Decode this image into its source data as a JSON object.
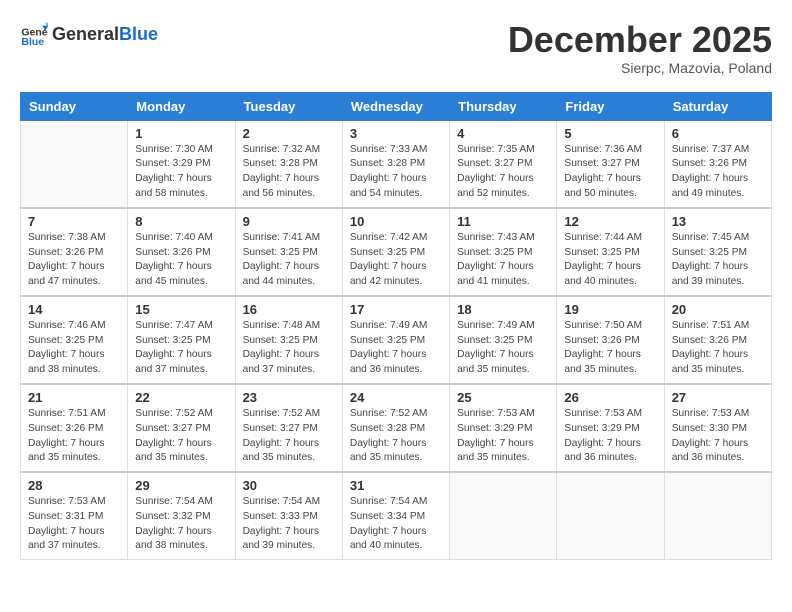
{
  "header": {
    "logo_general": "General",
    "logo_blue": "Blue",
    "month_title": "December 2025",
    "subtitle": "Sierpc, Mazovia, Poland"
  },
  "days_of_week": [
    "Sunday",
    "Monday",
    "Tuesday",
    "Wednesday",
    "Thursday",
    "Friday",
    "Saturday"
  ],
  "weeks": [
    [
      {
        "day": "",
        "info": ""
      },
      {
        "day": "1",
        "info": "Sunrise: 7:30 AM\nSunset: 3:29 PM\nDaylight: 7 hours\nand 58 minutes."
      },
      {
        "day": "2",
        "info": "Sunrise: 7:32 AM\nSunset: 3:28 PM\nDaylight: 7 hours\nand 56 minutes."
      },
      {
        "day": "3",
        "info": "Sunrise: 7:33 AM\nSunset: 3:28 PM\nDaylight: 7 hours\nand 54 minutes."
      },
      {
        "day": "4",
        "info": "Sunrise: 7:35 AM\nSunset: 3:27 PM\nDaylight: 7 hours\nand 52 minutes."
      },
      {
        "day": "5",
        "info": "Sunrise: 7:36 AM\nSunset: 3:27 PM\nDaylight: 7 hours\nand 50 minutes."
      },
      {
        "day": "6",
        "info": "Sunrise: 7:37 AM\nSunset: 3:26 PM\nDaylight: 7 hours\nand 49 minutes."
      }
    ],
    [
      {
        "day": "7",
        "info": "Sunrise: 7:38 AM\nSunset: 3:26 PM\nDaylight: 7 hours\nand 47 minutes."
      },
      {
        "day": "8",
        "info": "Sunrise: 7:40 AM\nSunset: 3:26 PM\nDaylight: 7 hours\nand 45 minutes."
      },
      {
        "day": "9",
        "info": "Sunrise: 7:41 AM\nSunset: 3:25 PM\nDaylight: 7 hours\nand 44 minutes."
      },
      {
        "day": "10",
        "info": "Sunrise: 7:42 AM\nSunset: 3:25 PM\nDaylight: 7 hours\nand 42 minutes."
      },
      {
        "day": "11",
        "info": "Sunrise: 7:43 AM\nSunset: 3:25 PM\nDaylight: 7 hours\nand 41 minutes."
      },
      {
        "day": "12",
        "info": "Sunrise: 7:44 AM\nSunset: 3:25 PM\nDaylight: 7 hours\nand 40 minutes."
      },
      {
        "day": "13",
        "info": "Sunrise: 7:45 AM\nSunset: 3:25 PM\nDaylight: 7 hours\nand 39 minutes."
      }
    ],
    [
      {
        "day": "14",
        "info": "Sunrise: 7:46 AM\nSunset: 3:25 PM\nDaylight: 7 hours\nand 38 minutes."
      },
      {
        "day": "15",
        "info": "Sunrise: 7:47 AM\nSunset: 3:25 PM\nDaylight: 7 hours\nand 37 minutes."
      },
      {
        "day": "16",
        "info": "Sunrise: 7:48 AM\nSunset: 3:25 PM\nDaylight: 7 hours\nand 37 minutes."
      },
      {
        "day": "17",
        "info": "Sunrise: 7:49 AM\nSunset: 3:25 PM\nDaylight: 7 hours\nand 36 minutes."
      },
      {
        "day": "18",
        "info": "Sunrise: 7:49 AM\nSunset: 3:25 PM\nDaylight: 7 hours\nand 35 minutes."
      },
      {
        "day": "19",
        "info": "Sunrise: 7:50 AM\nSunset: 3:26 PM\nDaylight: 7 hours\nand 35 minutes."
      },
      {
        "day": "20",
        "info": "Sunrise: 7:51 AM\nSunset: 3:26 PM\nDaylight: 7 hours\nand 35 minutes."
      }
    ],
    [
      {
        "day": "21",
        "info": "Sunrise: 7:51 AM\nSunset: 3:26 PM\nDaylight: 7 hours\nand 35 minutes."
      },
      {
        "day": "22",
        "info": "Sunrise: 7:52 AM\nSunset: 3:27 PM\nDaylight: 7 hours\nand 35 minutes."
      },
      {
        "day": "23",
        "info": "Sunrise: 7:52 AM\nSunset: 3:27 PM\nDaylight: 7 hours\nand 35 minutes."
      },
      {
        "day": "24",
        "info": "Sunrise: 7:52 AM\nSunset: 3:28 PM\nDaylight: 7 hours\nand 35 minutes."
      },
      {
        "day": "25",
        "info": "Sunrise: 7:53 AM\nSunset: 3:29 PM\nDaylight: 7 hours\nand 35 minutes."
      },
      {
        "day": "26",
        "info": "Sunrise: 7:53 AM\nSunset: 3:29 PM\nDaylight: 7 hours\nand 36 minutes."
      },
      {
        "day": "27",
        "info": "Sunrise: 7:53 AM\nSunset: 3:30 PM\nDaylight: 7 hours\nand 36 minutes."
      }
    ],
    [
      {
        "day": "28",
        "info": "Sunrise: 7:53 AM\nSunset: 3:31 PM\nDaylight: 7 hours\nand 37 minutes."
      },
      {
        "day": "29",
        "info": "Sunrise: 7:54 AM\nSunset: 3:32 PM\nDaylight: 7 hours\nand 38 minutes."
      },
      {
        "day": "30",
        "info": "Sunrise: 7:54 AM\nSunset: 3:33 PM\nDaylight: 7 hours\nand 39 minutes."
      },
      {
        "day": "31",
        "info": "Sunrise: 7:54 AM\nSunset: 3:34 PM\nDaylight: 7 hours\nand 40 minutes."
      },
      {
        "day": "",
        "info": ""
      },
      {
        "day": "",
        "info": ""
      },
      {
        "day": "",
        "info": ""
      }
    ]
  ]
}
